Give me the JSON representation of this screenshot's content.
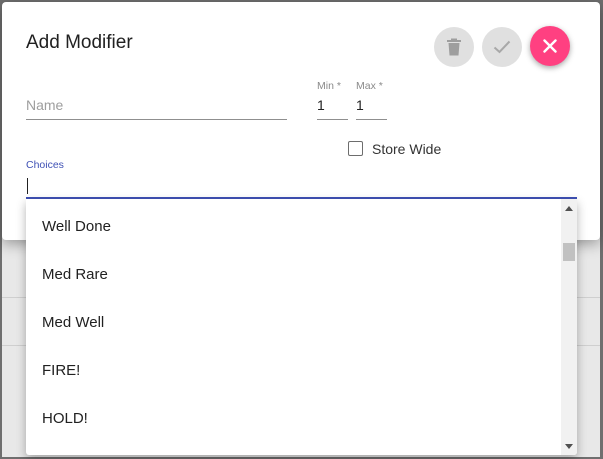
{
  "dialog": {
    "title": "Add Modifier",
    "actions": {
      "delete_icon": "trash-icon",
      "confirm_icon": "check-icon",
      "close_icon": "close-icon",
      "close_color": "#ff4081"
    }
  },
  "form": {
    "name": {
      "placeholder": "Name",
      "value": ""
    },
    "min": {
      "label": "Min *",
      "value": "1"
    },
    "max": {
      "label": "Max *",
      "value": "1"
    },
    "store_wide": {
      "label": "Store Wide",
      "checked": false
    },
    "choices": {
      "label": "Choices",
      "value": "",
      "accent_color": "#3f51b5"
    }
  },
  "dropdown": {
    "options": [
      "Well Done",
      "Med Rare",
      "Med Well",
      "FIRE!",
      "HOLD!"
    ]
  }
}
